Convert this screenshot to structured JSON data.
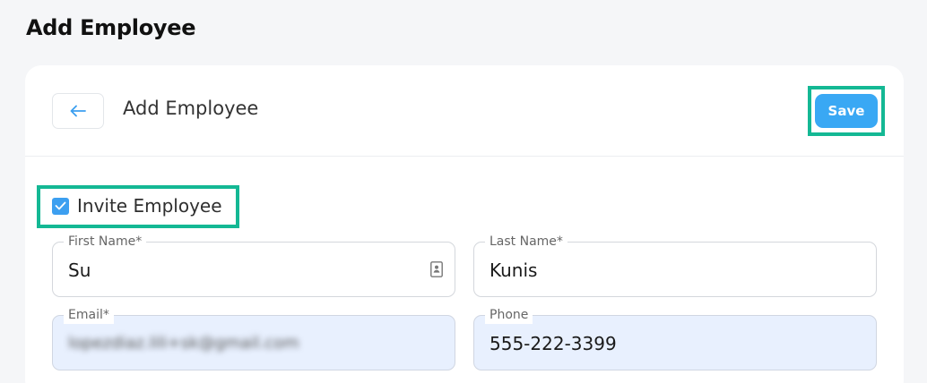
{
  "page": {
    "title": "Add Employee"
  },
  "header": {
    "back_icon": "arrow-left-icon",
    "title": "Add Employee",
    "save_label": "Save"
  },
  "invite": {
    "label": "Invite Employee",
    "checked": true
  },
  "form": {
    "first_name": {
      "label": "First Name*",
      "value": "Su",
      "icon": "contact-card-icon"
    },
    "last_name": {
      "label": "Last Name*",
      "value": "Kunis"
    },
    "email": {
      "label": "Email*",
      "value": "lopezdiaz.lili+sk@gmail.com"
    },
    "phone": {
      "label": "Phone",
      "value": "555-222-3399"
    }
  },
  "colors": {
    "accent": "#39a8f4",
    "highlight": "#14b894",
    "autofill": "#e8f0fe"
  }
}
